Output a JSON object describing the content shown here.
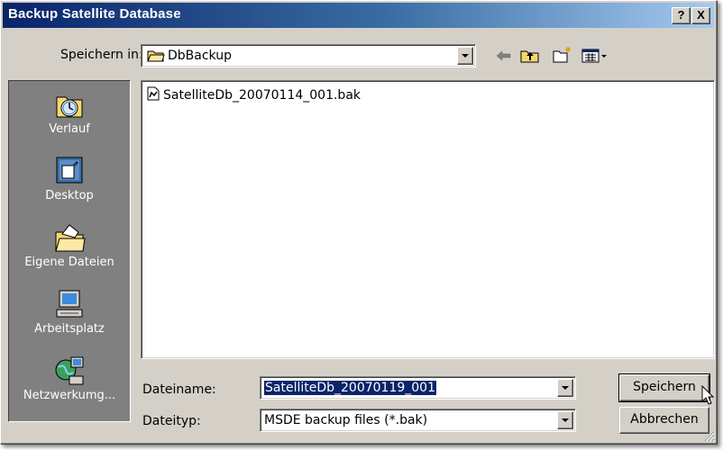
{
  "window": {
    "title": "Backup Satellite Database",
    "help_label": "?",
    "close_label": "X"
  },
  "save_in": {
    "label": "Speichern in:",
    "value": "DbBackup"
  },
  "toolbar": {
    "icons": [
      "back-arrow-icon",
      "up-folder-icon",
      "new-folder-icon",
      "view-menu-icon"
    ]
  },
  "places": [
    {
      "label": "Verlauf",
      "icon": "history-icon"
    },
    {
      "label": "Desktop",
      "icon": "desktop-icon"
    },
    {
      "label": "Eigene Dateien",
      "icon": "my-documents-icon"
    },
    {
      "label": "Arbeitsplatz",
      "icon": "my-computer-icon"
    },
    {
      "label": "Netzwerkumg...",
      "icon": "network-icon"
    }
  ],
  "files": [
    {
      "name": "SatelliteDb_20070114_001.bak",
      "icon": "bak-file-icon"
    }
  ],
  "filename": {
    "label": "Dateiname:",
    "value": "SatelliteDb_20070119_001"
  },
  "filetype": {
    "label": "Dateityp:",
    "value": "MSDE backup files (*.bak)"
  },
  "buttons": {
    "save": "Speichern",
    "cancel": "Abbrechen"
  },
  "colors": {
    "title_gradient_start": "#0a246a",
    "title_gradient_end": "#a6caf0",
    "dialog_bg": "#d4d0c8",
    "places_bg": "#808080",
    "selection": "#0a246a"
  }
}
